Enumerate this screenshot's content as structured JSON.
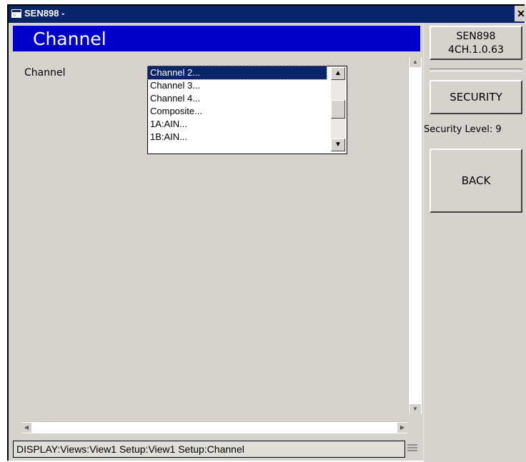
{
  "window": {
    "title": "SEN898 -",
    "close_glyph": "✕"
  },
  "header": {
    "title": "Channel"
  },
  "form": {
    "field_label": "Channel",
    "list_items": [
      "Channel 2...",
      "Channel 3...",
      "Channel 4...",
      "Composite...",
      "1A:AIN...",
      "1B:AIN..."
    ],
    "selected_index": 0
  },
  "sidebar": {
    "device_name": "SEN898",
    "device_version": "4CH.1.0.63",
    "security_label": "SECURITY",
    "security_level": "Security Level: 9",
    "back_label": "BACK"
  },
  "status": {
    "path": "DISPLAY:Views:View1 Setup:View1 Setup:Channel"
  },
  "colors": {
    "title_bar": "#0a246a",
    "header_bg": "#0000c8",
    "panel_bg": "#d6d3ce",
    "selection": "#0a246a"
  },
  "icons": {
    "app": "window-app-icon",
    "close": "close-icon",
    "scroll_up": "arrow-up-icon",
    "scroll_down": "arrow-down-icon"
  }
}
